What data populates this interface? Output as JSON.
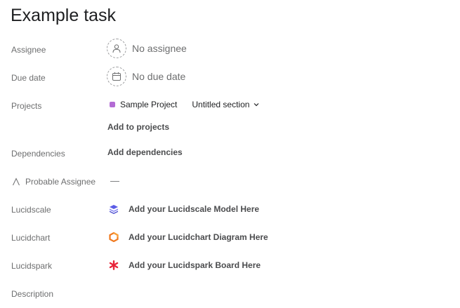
{
  "task": {
    "title": "Example task"
  },
  "fields": {
    "assignee": {
      "label": "Assignee",
      "value": "No assignee",
      "icon": "user-icon"
    },
    "due_date": {
      "label": "Due date",
      "value": "No due date",
      "icon": "calendar-icon"
    },
    "projects": {
      "label": "Projects",
      "project_name": "Sample Project",
      "project_color": "#b36bd4",
      "section": "Untitled section",
      "add_link": "Add to projects"
    },
    "dependencies": {
      "label": "Dependencies",
      "add_link": "Add dependencies"
    },
    "probable_assignee": {
      "label": "Probable Assignee",
      "icon": "text-field-icon",
      "value": "—"
    },
    "lucidscale": {
      "label": "Lucidscale",
      "link": "Add your Lucidscale Model Here",
      "icon": "lucidscale-logo-icon",
      "color": "#5b5ce6"
    },
    "lucidchart": {
      "label": "Lucidchart",
      "link": "Add your Lucidchart Diagram Here",
      "icon": "lucidchart-logo-icon",
      "color": "#f07a1f"
    },
    "lucidspark": {
      "label": "Lucidspark",
      "link": "Add your Lucidspark Board Here",
      "icon": "lucidspark-logo-icon",
      "color": "#e8253a"
    },
    "description": {
      "label": "Description"
    }
  }
}
